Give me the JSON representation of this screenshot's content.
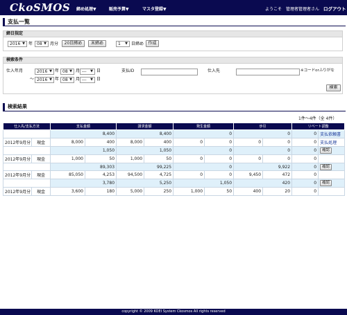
{
  "header": {
    "logo": "CkoSMOS",
    "nav": [
      "締め処理▼",
      "販売予算▼",
      "マスタ登録▼"
    ],
    "welcome": "ようこそ　管理者管理者さん",
    "logout": "ログアウト"
  },
  "page_title": "支払一覧",
  "closing": {
    "section_title": "締日指定",
    "year": "2016",
    "year_suffix": "年",
    "month": "08",
    "month_suffix": "月分",
    "btn_20": "20日締め",
    "btn_end": "末締め",
    "day": "1",
    "day_suffix": "日締め",
    "btn_create": "作成"
  },
  "search": {
    "section_title": "検索条件",
    "month_label": "仕入年月",
    "from_year": "2016",
    "from_month": "08",
    "from_day": "---",
    "to_prefix": "～",
    "to_year": "2016",
    "to_month": "08",
    "to_day": "---",
    "year_suffix": "年",
    "month_suffix": "月",
    "day_suffix": "日",
    "pay_id_label": "支払ID",
    "supplier_label": "仕入先",
    "supplier_note": "※コードorふりがな",
    "search_button": "検索"
  },
  "results": {
    "title": "検索結果",
    "count": "1件～4件（全 4件）",
    "columns": [
      "仕入先/支払方法",
      "支払金額",
      "",
      "請求金額",
      "",
      "発生金額",
      "",
      "歩引",
      "",
      "リベート調整",
      ""
    ],
    "rows": [
      {
        "type": "sum",
        "c": [
          "",
          "",
          "8,400",
          "",
          "8,400",
          "",
          "0",
          "",
          "0",
          "0",
          "支払依頼書"
        ],
        "link": true
      },
      {
        "type": "det",
        "date": "2012年9月分",
        "method": "現金",
        "c": [
          "8,000",
          "400",
          "8,000",
          "400",
          "0",
          "0",
          "0",
          "0",
          "0",
          "支払処理"
        ],
        "link": true
      },
      {
        "type": "sum",
        "c": [
          "",
          "",
          "1,050",
          "",
          "1,050",
          "",
          "0",
          "",
          "0",
          "0",
          "確認"
        ],
        "btn": true
      },
      {
        "type": "det",
        "date": "2012年9月分",
        "method": "現金",
        "c": [
          "1,000",
          "50",
          "1,000",
          "50",
          "0",
          "0",
          "0",
          "0",
          "0",
          ""
        ]
      },
      {
        "type": "sum",
        "c": [
          "",
          "",
          "89,303",
          "",
          "99,225",
          "",
          "0",
          "",
          "9,922",
          "0",
          "確認"
        ],
        "btn": true
      },
      {
        "type": "det",
        "date": "2012年9月分",
        "method": "現金",
        "c": [
          "85,050",
          "4,253",
          "94,500",
          "4,725",
          "0",
          "0",
          "9,450",
          "472",
          "0",
          ""
        ]
      },
      {
        "type": "sum",
        "c": [
          "",
          "",
          "3,780",
          "",
          "5,250",
          "",
          "1,050",
          "",
          "420",
          "0",
          "確認"
        ],
        "btn": true
      },
      {
        "type": "det",
        "date": "2012年9月分",
        "method": "現金",
        "c": [
          "3,600",
          "180",
          "5,000",
          "250",
          "1,000",
          "50",
          "400",
          "20",
          "0",
          ""
        ]
      }
    ]
  },
  "footer": "copyright © 2009 KOEI System Ckosmos All rights reserved"
}
